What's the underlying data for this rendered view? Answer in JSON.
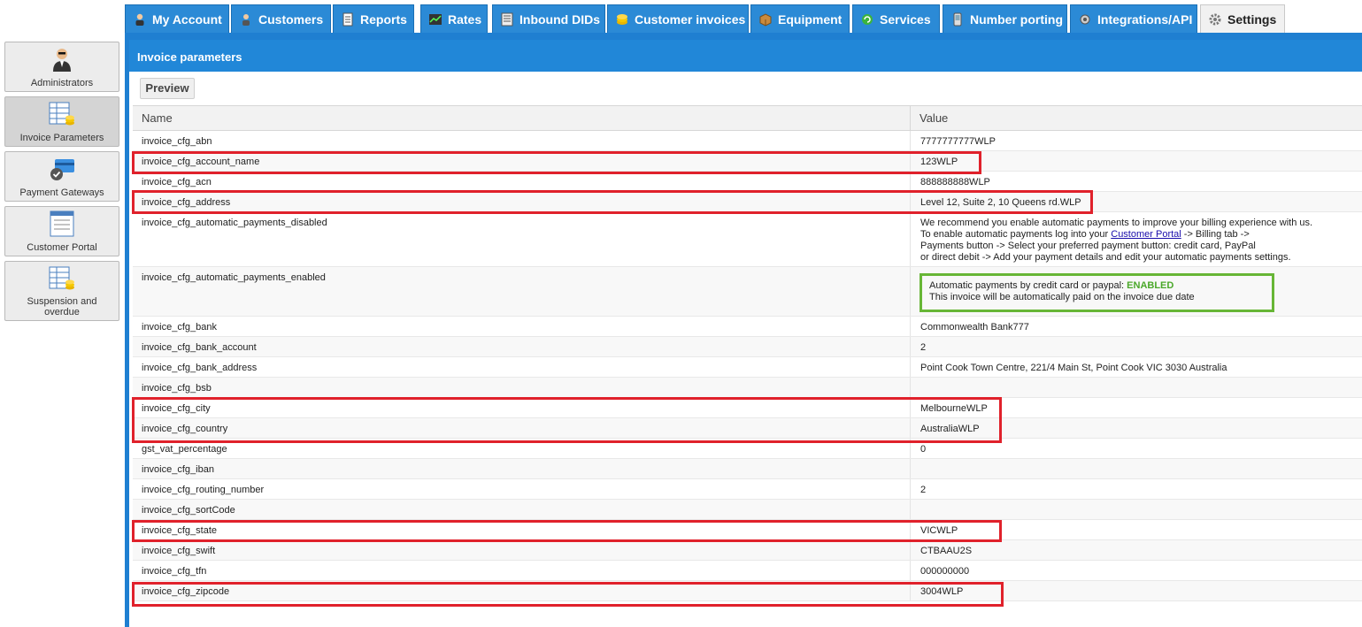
{
  "tabs": [
    {
      "label": "My Account",
      "icon": "user-icon"
    },
    {
      "label": "Customers",
      "icon": "customers-icon"
    },
    {
      "label": "Reports",
      "icon": "reports-icon"
    },
    {
      "label": "Rates",
      "icon": "rates-icon"
    },
    {
      "label": "Inbound DIDs",
      "icon": "inbound-dids-icon"
    },
    {
      "label": "Customer invoices",
      "icon": "coins-icon"
    },
    {
      "label": "Equipment",
      "icon": "box-icon"
    },
    {
      "label": "Services",
      "icon": "services-icon"
    },
    {
      "label": "Number porting",
      "icon": "phone-icon"
    },
    {
      "label": "Integrations/API",
      "icon": "api-icon"
    },
    {
      "label": "Settings",
      "icon": "gear-icon",
      "active": true
    }
  ],
  "sidebar": {
    "items": [
      {
        "label": "Administrators",
        "icon": "administrator-icon"
      },
      {
        "label": "Invoice Parameters",
        "icon": "invoice-parameters-icon",
        "active": true
      },
      {
        "label": "Payment Gateways",
        "icon": "payment-gateway-icon"
      },
      {
        "label": "Customer Portal",
        "icon": "customer-portal-icon"
      },
      {
        "label": "Suspension and overdue",
        "icon": "suspension-icon"
      }
    ]
  },
  "panel": {
    "title": "Invoice parameters",
    "preview_label": "Preview"
  },
  "table": {
    "headers": {
      "name": "Name",
      "value": "Value"
    },
    "rows": [
      {
        "name": "invoice_cfg_abn",
        "value": "7777777777WLP"
      },
      {
        "name": "invoice_cfg_account_name",
        "value": "123WLP"
      },
      {
        "name": "invoice_cfg_acn",
        "value": "888888888WLP"
      },
      {
        "name": "invoice_cfg_address",
        "value": "Level 12, Suite 2, 10 Queens rd.WLP"
      },
      {
        "name": "invoice_cfg_automatic_payments_disabled",
        "value_lines": {
          "l1": "We recommend you enable automatic payments to improve your billing experience with us.",
          "l2_pre": "To enable automatic payments log into your ",
          "l2_link": "Customer Portal",
          "l2_post": " -> Billing tab ->",
          "l3": "Payments button -> Select your preferred payment button: credit card, PayPal",
          "l4": "or direct debit -> Add your payment details and edit your automatic payments settings."
        }
      },
      {
        "name": "invoice_cfg_automatic_payments_enabled",
        "value_lines": {
          "l1_pre": "Automatic payments by credit card or paypal: ",
          "l1_status": "ENABLED",
          "l2": "This invoice will be automatically paid on the invoice due date"
        }
      },
      {
        "name": "invoice_cfg_bank",
        "value": "Commonwealth Bank777"
      },
      {
        "name": "invoice_cfg_bank_account",
        "value": "2"
      },
      {
        "name": "invoice_cfg_bank_address",
        "value": "Point Cook Town Centre, 221/4 Main St, Point Cook VIC 3030 Australia"
      },
      {
        "name": "invoice_cfg_bsb",
        "value": ""
      },
      {
        "name": "invoice_cfg_city",
        "value": "MelbourneWLP"
      },
      {
        "name": "invoice_cfg_country",
        "value": "AustraliaWLP"
      },
      {
        "name": "gst_vat_percentage",
        "value": "0"
      },
      {
        "name": "invoice_cfg_iban",
        "value": ""
      },
      {
        "name": "invoice_cfg_routing_number",
        "value": "2"
      },
      {
        "name": "invoice_cfg_sortCode",
        "value": ""
      },
      {
        "name": "invoice_cfg_state",
        "value": "VICWLP"
      },
      {
        "name": "invoice_cfg_swift",
        "value": "CTBAAU2S"
      },
      {
        "name": "invoice_cfg_tfn",
        "value": "000000000"
      },
      {
        "name": "invoice_cfg_zipcode",
        "value": "3004WLP"
      }
    ]
  },
  "colors": {
    "tab_blue": "#2b8ad6",
    "panel_blue": "#2187d8",
    "highlight_red": "#e0212b",
    "enabled_green": "#67b636"
  }
}
